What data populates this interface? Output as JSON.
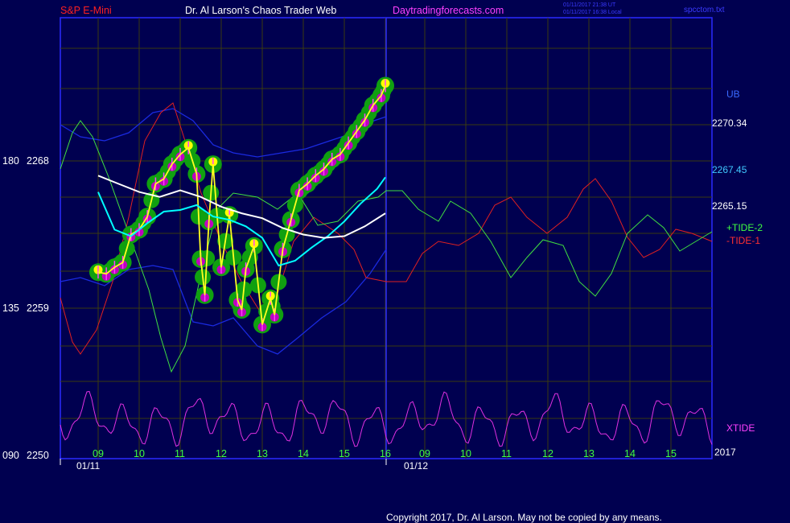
{
  "header": {
    "symbol": "S&P E-Mini",
    "title": "Dr. Al Larson's Chaos Trader Web",
    "website": "Daytradingforecasts.com",
    "stamp_utc": "01/11/2017 21:38 UT",
    "stamp_local": "01/11/2017 16:38 Local",
    "filename": "spcctom.txt"
  },
  "footer": {
    "copyright": "Copyright 2017, Dr. Al Larson. May not be copied by any means."
  },
  "chart_data": {
    "type": "line",
    "title": "S&P E-Mini",
    "y_axis": {
      "price_ticks": [
        2268,
        2259,
        2250
      ],
      "angle_ticks": [
        180,
        135,
        "090"
      ],
      "ylim": [
        2250,
        2275
      ]
    },
    "x_axis": {
      "hour_ticks_day1": [
        "09",
        "10",
        "11",
        "12",
        "13",
        "14",
        "15",
        "16"
      ],
      "hour_ticks_day2": [
        "09",
        "10",
        "11",
        "12",
        "13",
        "14",
        "15",
        "16"
      ],
      "date_labels": [
        "01/11",
        "01/12"
      ],
      "year_label": "2017"
    },
    "price_levels": {
      "ub": "UB",
      "upper": "2270.34",
      "middle": "2267.45",
      "lower": "2265.15"
    },
    "legend": {
      "tide_plus": "+TIDE-2",
      "tide_minus": "-TIDE-1",
      "xtide": "XTIDE"
    },
    "series": [
      {
        "name": "price (yellow)",
        "color": "#ffff00",
        "x": [
          9.0,
          9.2,
          9.4,
          9.6,
          9.8,
          10.0,
          10.2,
          10.4,
          10.6,
          10.8,
          11.0,
          11.2,
          11.4,
          11.5,
          11.6,
          11.7,
          11.8,
          12.0,
          12.2,
          12.4,
          12.5,
          12.6,
          12.8,
          13.0,
          13.2,
          13.3,
          13.5,
          13.7,
          13.9,
          14.1,
          14.3,
          14.5,
          14.7,
          14.9,
          15.1,
          15.3,
          15.5,
          15.7,
          15.9,
          16.0
        ],
        "y": [
          2261.2,
          2261.1,
          2261.5,
          2261.8,
          2263.5,
          2263.8,
          2264.6,
          2266.6,
          2266.9,
          2267.8,
          2268.4,
          2268.8,
          2267.2,
          2262.0,
          2259.8,
          2264.3,
          2267.8,
          2261.5,
          2264.7,
          2259.5,
          2258.9,
          2261.4,
          2262.8,
          2258.0,
          2259.6,
          2258.6,
          2262.6,
          2264.4,
          2266.2,
          2266.6,
          2267.1,
          2267.5,
          2268.1,
          2268.4,
          2269.1,
          2269.8,
          2270.5,
          2271.4,
          2272.0,
          2272.6
        ]
      },
      {
        "name": "average (cyan)",
        "color": "#00ffff",
        "x": [
          9.0,
          9.4,
          9.8,
          10.2,
          10.6,
          11.0,
          11.4,
          11.8,
          12.2,
          12.6,
          13.0,
          13.4,
          13.8,
          14.2,
          14.6,
          15.0,
          15.4,
          15.8,
          16.0
        ],
        "y": [
          2266.1,
          2263.8,
          2263.4,
          2264.2,
          2264.9,
          2265.0,
          2265.3,
          2264.6,
          2264.4,
          2264.0,
          2263.3,
          2261.6,
          2261.9,
          2262.7,
          2263.4,
          2264.3,
          2265.4,
          2266.3,
          2267.0
        ]
      },
      {
        "name": "average (white)",
        "color": "#ffffff",
        "x": [
          9.0,
          9.5,
          10.0,
          10.5,
          11.0,
          11.5,
          12.0,
          12.5,
          13.0,
          13.5,
          14.0,
          14.5,
          15.0,
          15.5,
          16.0
        ],
        "y": [
          2267.1,
          2266.6,
          2266.1,
          2265.8,
          2266.2,
          2265.8,
          2265.2,
          2264.8,
          2264.5,
          2263.9,
          2263.5,
          2263.3,
          2263.4,
          2264.0,
          2264.8
        ]
      }
    ]
  }
}
